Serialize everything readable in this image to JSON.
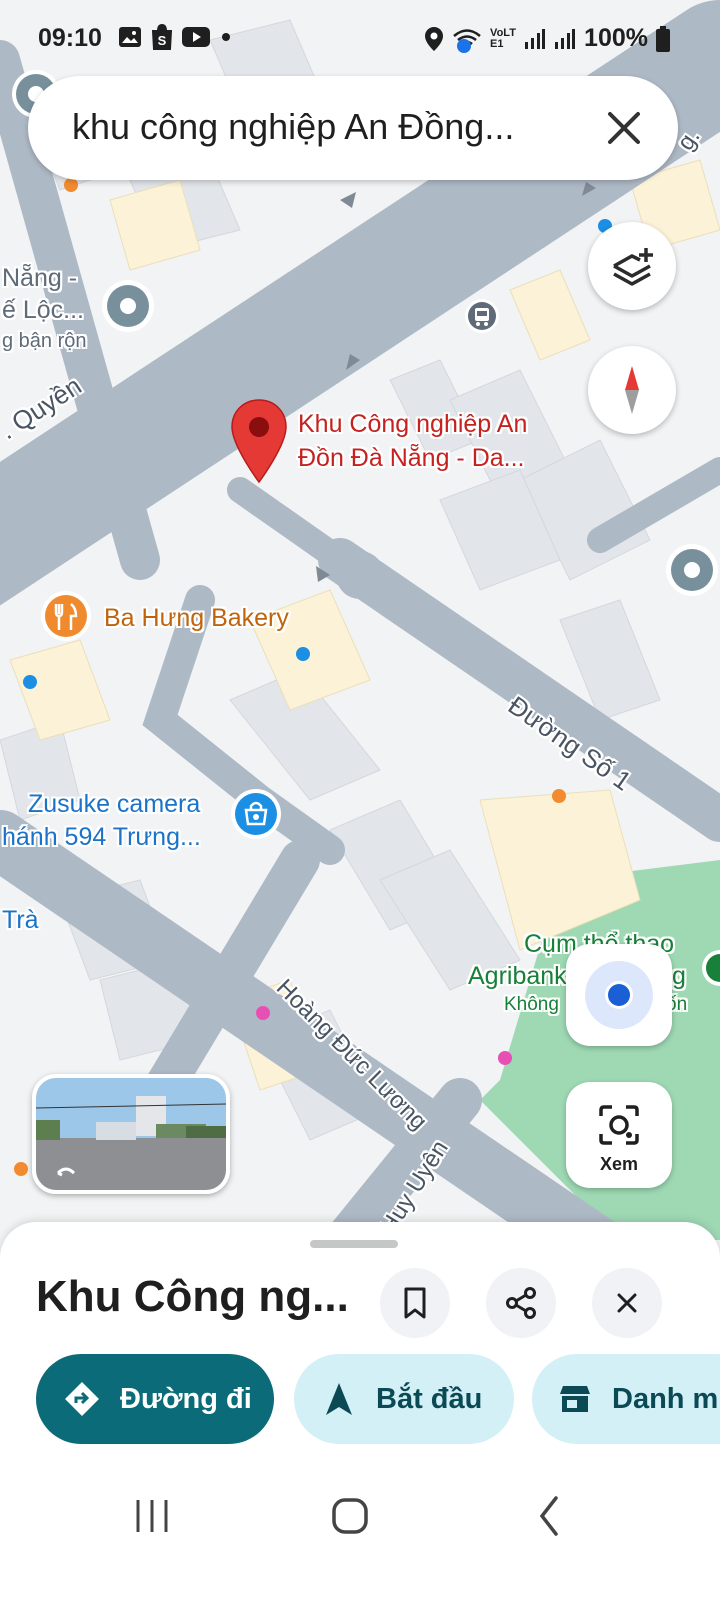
{
  "status_bar": {
    "time": "09:10",
    "battery": "100%",
    "network_label": "VoLTE1"
  },
  "search": {
    "query": "khu công nghiệp An Đồng..."
  },
  "map": {
    "roads": {
      "quyen": ". Quyền",
      "duong_so_1": "Đường Số 1",
      "hoang_duc_luong": "Hoàng Đức Lương",
      "huy_uyen": "Huy Uyên",
      "top_right": "g."
    },
    "selected_place": {
      "line1": "Khu Công nghiệp An",
      "line2": "Đồn Đà Nẵng - Da..."
    },
    "places": {
      "left_top_line1": "Nẵng -",
      "left_top_line2": "ế Lộc...",
      "left_top_line3": "g bận rộn",
      "bakery": "Ba Hưng Bakery",
      "camera_line1": "Zusuke camera",
      "camera_line2": "hánh 594 Trưng...",
      "tra": "Trà",
      "sports_line1": "Cụm thể thao",
      "sports_line2": "Agribank",
      "sports_line3": "Không",
      "sports_line3_suffix": "ốn",
      "sports_suffix": "g"
    },
    "lens_label": "Xem"
  },
  "sheet": {
    "title": "Khu Công ng...",
    "actions": {
      "directions": "Đường đi",
      "start": "Bắt đầu",
      "menu": "Danh m"
    }
  },
  "colors": {
    "primary": "#0b6b78",
    "secondary": "#d3f0f7",
    "pin": "#e53935",
    "road": "#aeb9c6",
    "park": "#8fd4a8"
  },
  "icons": [
    "gallery-icon",
    "shop-icon",
    "youtube-icon",
    "location-icon",
    "wifi-icon",
    "signal-icon",
    "battery-icon",
    "close-icon",
    "layers-icon",
    "compass-icon",
    "my-location-icon",
    "lens-icon",
    "bookmark-icon",
    "share-icon",
    "directions-icon",
    "navigation-icon",
    "store-icon",
    "recents-icon",
    "home-icon",
    "back-icon"
  ]
}
